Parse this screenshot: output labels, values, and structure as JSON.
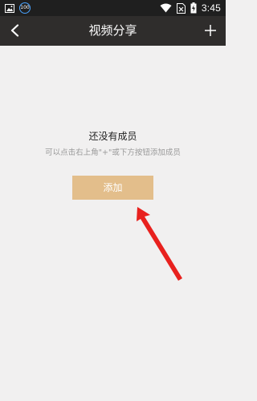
{
  "status_bar": {
    "badge_text": "100",
    "time": "3:45",
    "icons": [
      "image-icon",
      "badge-100-icon",
      "wifi-icon",
      "sim-icon",
      "battery-charging-icon"
    ]
  },
  "app_bar": {
    "title": "视频分享",
    "back_icon": "chevron-left-icon",
    "add_icon": "plus-icon"
  },
  "empty_state": {
    "title": "还没有成员",
    "hint": "可以点击右上角\"+\"或下方按钮添加成员",
    "button_label": "添加"
  },
  "colors": {
    "status_bar_bg": "#1f1f1f",
    "app_bar_bg": "#2f2d2c",
    "page_bg": "#f1f0f0",
    "button_bg": "#e3be8b",
    "annotation": "#e8211e"
  }
}
